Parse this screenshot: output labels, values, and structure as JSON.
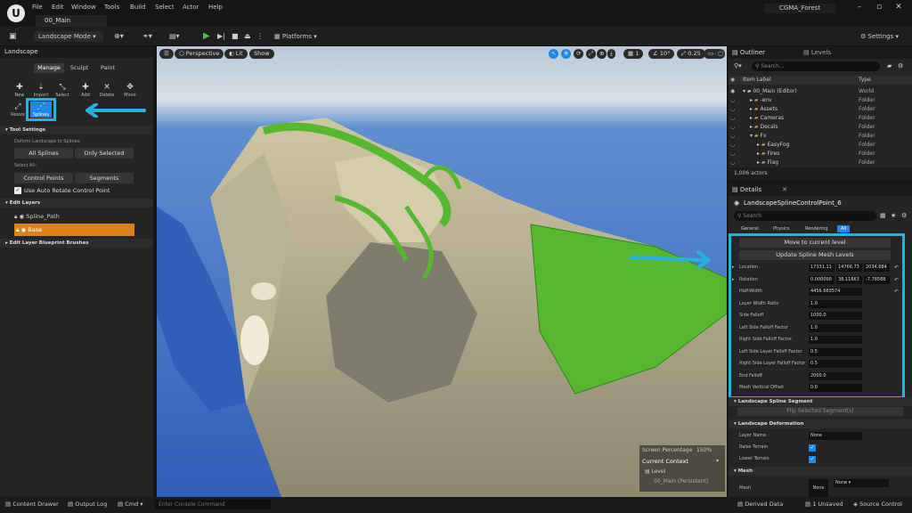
{
  "colors": {
    "accent": "#1a8ae6",
    "highlight": "#2ab0e0",
    "layer_selected": "#d9831a",
    "landscape_green": "#55b82e"
  },
  "titlebar": {
    "menu": [
      "File",
      "Edit",
      "Window",
      "Tools",
      "Build",
      "Select",
      "Actor",
      "Help"
    ],
    "level_tab": "00_Main",
    "project": "CGMA_Forest"
  },
  "toolbar": {
    "mode": "Landscape Mode",
    "platforms": "Platforms",
    "settings": "Settings"
  },
  "landscape": {
    "title": "Landscape",
    "modes": [
      "Manage",
      "Sculpt",
      "Paint"
    ],
    "tools": [
      "New",
      "Import",
      "Select",
      "Add",
      "Delete",
      "Move",
      "Resize",
      "Splines"
    ],
    "tool_settings": "Tool Settings",
    "deform_label": "Deform Landscape to Splines:",
    "all_splines": "All Splines",
    "only_selected": "Only Selected",
    "select_all": "Select All:",
    "control_points": "Control Points",
    "segments": "Segments",
    "auto_rotate": "Use Auto Rotate Control Point",
    "edit_layers": "Edit Layers",
    "layers": [
      "Spline_Path",
      "Base"
    ],
    "edit_layer_blueprint": "Edit Layer Blueprint Brushes"
  },
  "viewport": {
    "perspective": "Perspective",
    "lit": "Lit",
    "show": "Show",
    "grid": "1",
    "angle": "10°",
    "scale": "0.25",
    "camera_speed": "4",
    "screen_percentage": "Screen Percentage",
    "screen_percentage_value": "150%",
    "current_context": "Current Context",
    "level_label": "Level",
    "level_value": "00_Main (Persistent)"
  },
  "outliner": {
    "tab": "Outliner",
    "levels_tab": "Levels",
    "search_placeholder": "Search...",
    "col_label": "Item Label",
    "col_type": "Type",
    "rows": [
      {
        "label": "00_Main (Editor)",
        "type": "World",
        "indent": 0
      },
      {
        "label": "-env",
        "type": "Folder",
        "indent": 1
      },
      {
        "label": "Assets",
        "type": "Folder",
        "indent": 1
      },
      {
        "label": "Cameras",
        "type": "Folder",
        "indent": 1
      },
      {
        "label": "Decals",
        "type": "Folder",
        "indent": 1
      },
      {
        "label": "Fx",
        "type": "Folder",
        "indent": 1
      },
      {
        "label": "EasyFog",
        "type": "Folder",
        "indent": 2
      },
      {
        "label": "Fires",
        "type": "Folder",
        "indent": 2
      },
      {
        "label": "Flag",
        "type": "Folder",
        "indent": 2
      }
    ],
    "actor_count": "1,006 actors"
  },
  "details": {
    "tab": "Details",
    "object": "LandscapeSplineControlPoint_6",
    "search_placeholder": "Search",
    "tabs": [
      "General",
      "Physics",
      "Rendering",
      "All"
    ],
    "move_to_level": "Move to current level",
    "update_mesh": "Update Spline Mesh Levels",
    "props": [
      {
        "label": "Location",
        "values": [
          "17331.11",
          "14766.73",
          "2034.684"
        ]
      },
      {
        "label": "Rotation",
        "values": [
          "0.000000",
          "38.11663",
          "-7.78588"
        ]
      },
      {
        "label": "Half-Width",
        "values": [
          "4456.663574"
        ]
      },
      {
        "label": "Layer Width Ratio",
        "values": [
          "1.0"
        ]
      },
      {
        "label": "Side Falloff",
        "values": [
          "1000.0"
        ]
      },
      {
        "label": "Left Side Falloff Factor",
        "values": [
          "1.0"
        ]
      },
      {
        "label": "Right Side Falloff Factor",
        "values": [
          "1.0"
        ]
      },
      {
        "label": "Left Side Layer Falloff Factor",
        "values": [
          "0.5"
        ]
      },
      {
        "label": "Right Side Layer Falloff Factor",
        "values": [
          "0.5"
        ]
      },
      {
        "label": "End Falloff",
        "values": [
          "2000.0"
        ]
      },
      {
        "label": "Mesh Vertical Offset",
        "values": [
          "0.0"
        ]
      }
    ],
    "segment_section": "Landscape Spline Segment",
    "flip_segment": "Flip Selected Segment(s)",
    "deformation_section": "Landscape Deformation",
    "layer_name": "Layer Name",
    "layer_name_value": "None",
    "raise_terrain": "Raise Terrain",
    "lower_terrain": "Lower Terrain",
    "mesh_section": "Mesh",
    "mesh_label": "Mesh",
    "mesh_value": "None",
    "mesh_thumb": "None"
  },
  "statusbar": {
    "content_drawer": "Content Drawer",
    "output_log": "Output Log",
    "cmd": "Cmd",
    "console_placeholder": "Enter Console Command",
    "derived_data": "Derived Data",
    "unsaved": "1 Unsaved",
    "source_control": "Source Control"
  }
}
